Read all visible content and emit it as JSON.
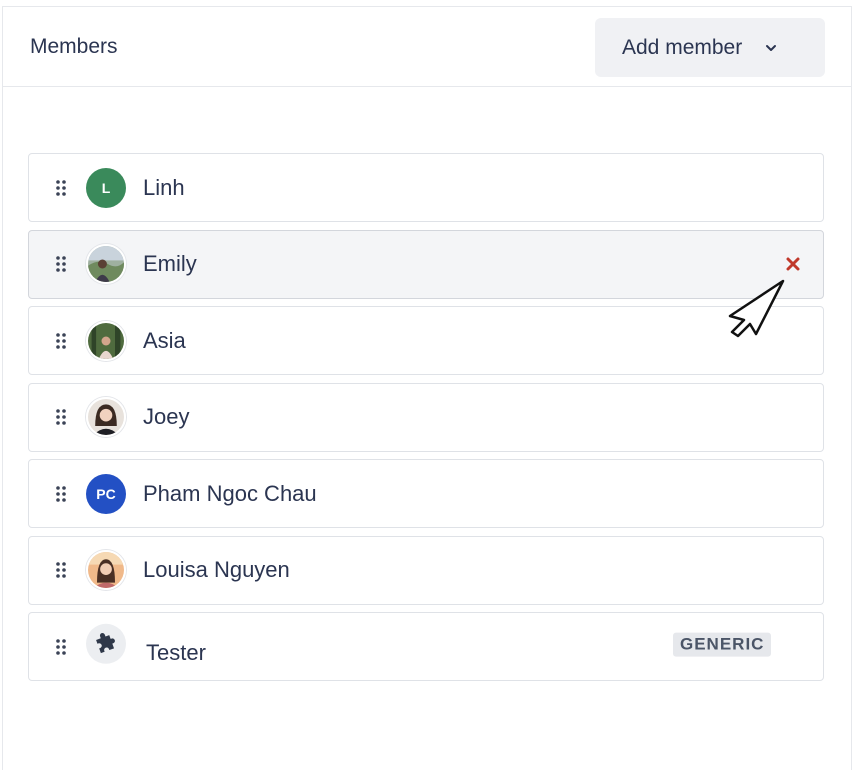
{
  "header": {
    "title": "Members",
    "add_button_label": "Add member",
    "add_button_icon": "chevron-down-icon"
  },
  "members": [
    {
      "name": "Linh",
      "avatar_type": "initials",
      "initials": "L",
      "avatar_color": "#3a8a5b"
    },
    {
      "name": "Emily",
      "avatar_type": "photo",
      "hovered": true,
      "remove_icon": "close-icon",
      "remove_color": "#c0392b"
    },
    {
      "name": "Asia",
      "avatar_type": "photo"
    },
    {
      "name": "Joey",
      "avatar_type": "photo"
    },
    {
      "name": "Pham Ngoc Chau",
      "avatar_type": "initials",
      "initials": "PC",
      "avatar_color": "#2350c4"
    },
    {
      "name": "Louisa Nguyen",
      "avatar_type": "photo"
    },
    {
      "name": "Tester",
      "avatar_type": "icon",
      "avatar_icon": "puzzle-icon",
      "badge": "GENERIC"
    }
  ],
  "colors": {
    "text": "#2b3551",
    "border": "#dfe2e7",
    "hover_bg": "#f4f5f7",
    "button_bg": "#f0f1f4",
    "remove": "#c0392b"
  }
}
